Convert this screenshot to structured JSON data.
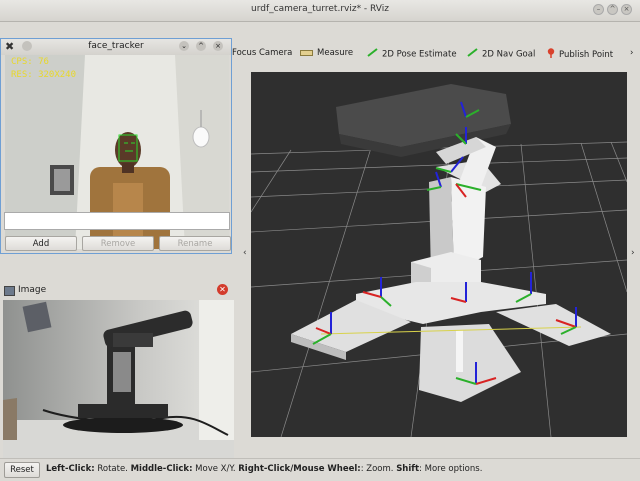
{
  "window": {
    "title": "urdf_camera_turret.rviz* - RViz"
  },
  "toolbar": {
    "items": [
      {
        "label": "Focus Camera",
        "icon": "focus-camera-icon"
      },
      {
        "label": "Measure",
        "icon": "ruler-icon"
      },
      {
        "label": "2D Pose Estimate",
        "icon": "green-arrow-icon"
      },
      {
        "label": "2D Nav Goal",
        "icon": "green-arrow-icon"
      },
      {
        "label": "Publish Point",
        "icon": "map-pin-icon"
      }
    ],
    "overflow": "›"
  },
  "face_tracker": {
    "title": "face_tracker",
    "cps": "CPS: 76",
    "res": "RES: 320X240",
    "text_color": "#e8d82a"
  },
  "panel": {
    "add_label": "Add",
    "remove_label": "Remove",
    "rename_label": "Rename"
  },
  "image_panel": {
    "title": "Image"
  },
  "viewport": {
    "left_arrow": "‹",
    "right_arrow": "›"
  },
  "status": {
    "reset_label": "Reset",
    "help_segments": [
      {
        "k": "Left-Click:",
        "v": " Rotate. "
      },
      {
        "k": "Middle-Click:",
        "v": " Move X/Y. "
      },
      {
        "k": "Right-Click/Mouse Wheel:",
        "v": ": Zoom. "
      },
      {
        "k": "Shift",
        "v": ": More options."
      }
    ]
  },
  "colors": {
    "accent": "#6f9fd4",
    "grid": "#8a8a8a",
    "background": "#2f2f2f"
  }
}
